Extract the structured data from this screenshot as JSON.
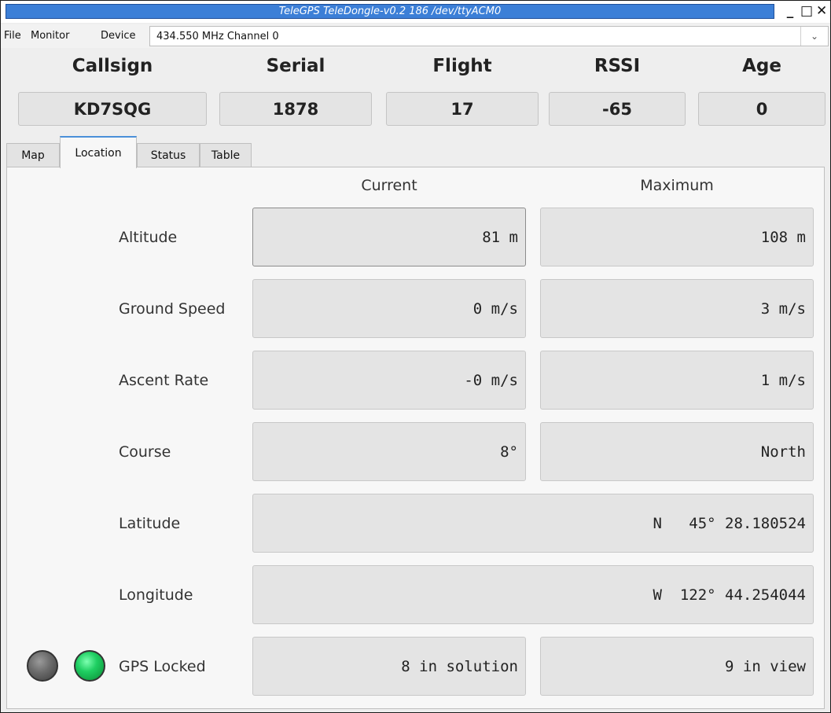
{
  "window": {
    "title": "TeleGPS TeleDongle-v0.2 186 /dev/ttyACM0",
    "buttons": {
      "minimize": "_",
      "maximize": "□",
      "close": "✕"
    }
  },
  "menubar": {
    "items": [
      "File",
      "Monitor",
      "Device"
    ],
    "channel_select": {
      "value": "434.550 MHz Channel 0",
      "chevron": "⌄"
    }
  },
  "header": {
    "fields": [
      {
        "label": "Callsign",
        "value": "KD7SQG"
      },
      {
        "label": "Serial",
        "value": "1878"
      },
      {
        "label": "Flight",
        "value": "17"
      },
      {
        "label": "RSSI",
        "value": "-65"
      },
      {
        "label": "Age",
        "value": "0"
      }
    ]
  },
  "tabs": [
    {
      "label": "Map",
      "active": false
    },
    {
      "label": "Location",
      "active": true
    },
    {
      "label": "Status",
      "active": false
    },
    {
      "label": "Table",
      "active": false
    }
  ],
  "location": {
    "column_current": "Current",
    "column_maximum": "Maximum",
    "rows": [
      {
        "label": "Altitude",
        "current": "81 m",
        "maximum": "108 m"
      },
      {
        "label": "Ground Speed",
        "current": "0 m/s",
        "maximum": "3 m/s"
      },
      {
        "label": "Ascent Rate",
        "current": "-0 m/s",
        "maximum": "1 m/s"
      },
      {
        "label": "Course",
        "current": "8°",
        "maximum": "North"
      },
      {
        "label": "Latitude",
        "value": "N   45° 28.180524"
      },
      {
        "label": "Longitude",
        "value": "W  122° 44.254044"
      },
      {
        "label": "GPS Locked",
        "current": "8 in solution",
        "maximum": "9 in view"
      }
    ],
    "gps_indicators": {
      "off_color": "#5a5a5a",
      "on_color": "#1fcf62"
    }
  }
}
